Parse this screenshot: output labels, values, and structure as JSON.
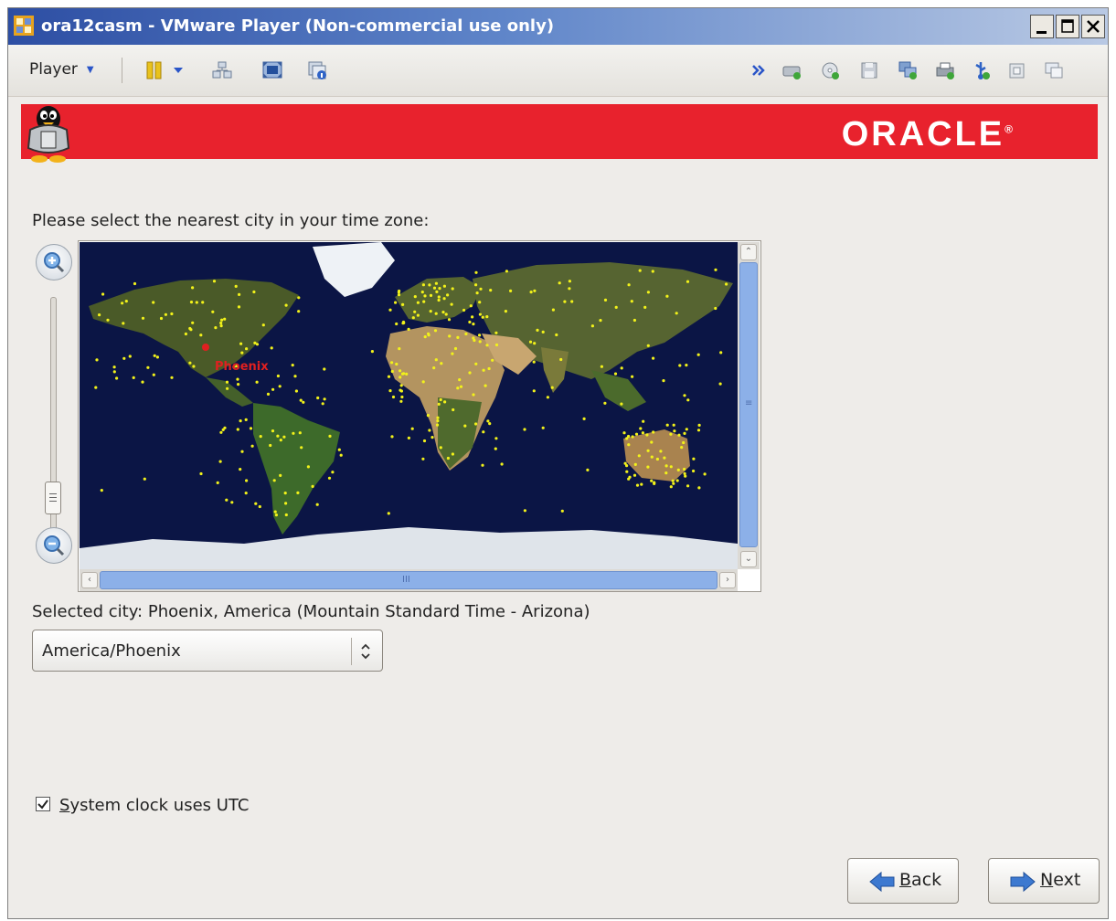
{
  "window": {
    "title": "ora12casm - VMware Player (Non-commercial use only)"
  },
  "toolbar": {
    "player_menu": "Player",
    "icons": [
      "pause-icon",
      "send-ctrl-alt-del-icon",
      "fullscreen-icon",
      "unity-icon",
      "more-icon",
      "hard-disk-icon",
      "cd-dvd-icon",
      "floppy-icon",
      "network-icon",
      "printer-icon",
      "usb-icon",
      "sound-icon",
      "display-icon"
    ]
  },
  "banner": {
    "brand": "ORACLE",
    "brand_mark": "®",
    "color": "#e8222d"
  },
  "timezone": {
    "prompt": "Please select the nearest city in your time zone:",
    "map_selected_label": "Phoenix",
    "selected_city_text": "Selected city: Phoenix, America (Mountain Standard Time - Arizona)",
    "select_value": "America/Phoenix",
    "utc_checked": true,
    "utc_label_prefix": "",
    "utc_label_mnemonic": "S",
    "utc_label_rest": "ystem clock uses UTC"
  },
  "scrollbars": {
    "vertical_grip": "≡",
    "horizontal_grip": "III"
  },
  "buttons": {
    "back_mnemonic": "B",
    "back_rest": "ack",
    "next_mnemonic": "N",
    "next_rest": "ext"
  }
}
